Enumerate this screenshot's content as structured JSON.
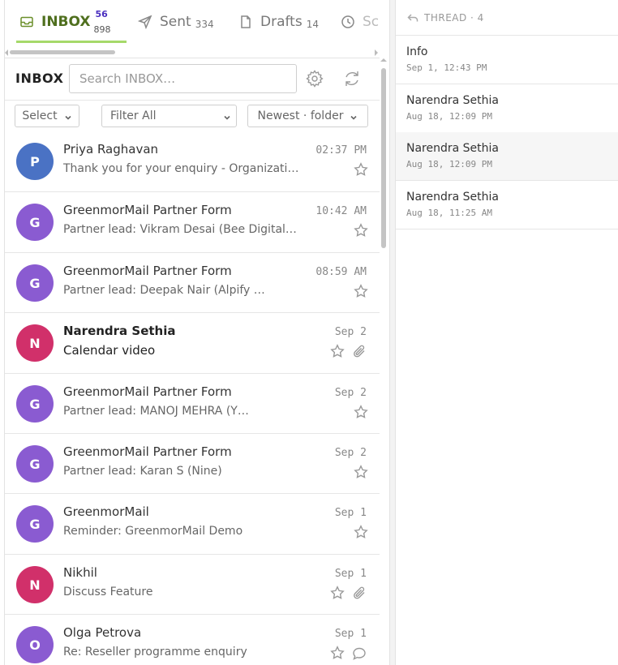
{
  "tabs": {
    "inbox": {
      "label": "INBOX",
      "unread": "56",
      "total": "898"
    },
    "sent": {
      "label": "Sent",
      "count": "334"
    },
    "drafts": {
      "label": "Drafts",
      "count": "14"
    },
    "scheduled": {
      "label": "Sc"
    }
  },
  "toolbar": {
    "folder_title": "INBOX",
    "search_placeholder": "Search INBOX…",
    "icons": [
      "gear-icon",
      "refresh-icon"
    ]
  },
  "filters": {
    "select_label": "Select",
    "filter_label": "Filter All",
    "sort_label": "Newest · folder"
  },
  "messages": [
    {
      "initial": "P",
      "avatar_color": "#4a72c4",
      "sender": "Priya Raghavan",
      "subject": "Thank you for your enquiry - Organization…",
      "date": "02:37 PM",
      "unread": false,
      "attachment": false,
      "comment": false
    },
    {
      "initial": "G",
      "avatar_color": "#8a5bd1",
      "sender": "GreenmorMail Partner Form",
      "subject": "Partner lead: Vikram Desai (Bee Digital…",
      "date": "10:42 AM",
      "unread": false,
      "attachment": false,
      "comment": false
    },
    {
      "initial": "G",
      "avatar_color": "#8a5bd1",
      "sender": "GreenmorMail Partner Form",
      "subject": "Partner lead: Deepak Nair (Alpify …",
      "date": "08:59 AM",
      "unread": false,
      "attachment": false,
      "comment": false
    },
    {
      "initial": "N",
      "avatar_color": "#d1306a",
      "sender": "Narendra Sethia",
      "subject": "Calendar video",
      "date": "Sep 2",
      "unread": true,
      "attachment": true,
      "comment": false
    },
    {
      "initial": "G",
      "avatar_color": "#8a5bd1",
      "sender": "GreenmorMail Partner Form",
      "subject": "Partner lead: MANOJ MEHRA (Y…",
      "date": "Sep 2",
      "unread": false,
      "attachment": false,
      "comment": false
    },
    {
      "initial": "G",
      "avatar_color": "#8a5bd1",
      "sender": "GreenmorMail Partner Form",
      "subject": "Partner lead: Karan S (Nine)",
      "date": "Sep 2",
      "unread": false,
      "attachment": false,
      "comment": false
    },
    {
      "initial": "G",
      "avatar_color": "#8a5bd1",
      "sender": "GreenmorMail",
      "subject": "Reminder: GreenmorMail Demo",
      "date": "Sep 1",
      "unread": false,
      "attachment": false,
      "comment": false
    },
    {
      "initial": "N",
      "avatar_color": "#d1306a",
      "sender": "Nikhil",
      "subject": "Discuss Feature",
      "date": "Sep 1",
      "unread": false,
      "attachment": true,
      "comment": false
    },
    {
      "initial": "O",
      "avatar_color": "#8a5bd1",
      "sender": "Olga Petrova",
      "subject": "Re: Reseller programme enquiry",
      "date": "Sep 1",
      "unread": false,
      "attachment": false,
      "comment": true
    }
  ],
  "thread": {
    "header": "THREAD · 4",
    "items": [
      {
        "name": "Info",
        "time": "Sep 1, 12:43 PM",
        "active": false
      },
      {
        "name": "Narendra Sethia",
        "time": "Aug 18, 12:09 PM",
        "active": false
      },
      {
        "name": "Narendra Sethia",
        "time": "Aug 18, 12:09 PM",
        "active": true
      },
      {
        "name": "Narendra Sethia",
        "time": "Aug 18, 11:25 AM",
        "active": false
      }
    ]
  },
  "colors": {
    "accent_green": "#6b8f2a",
    "tab_underline": "#a6d96a",
    "unread_badge": "#4a2fbf"
  }
}
